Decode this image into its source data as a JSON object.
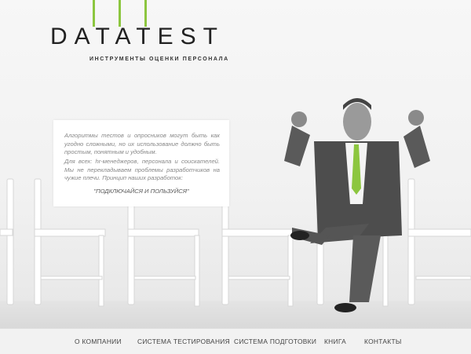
{
  "brand": {
    "logo_text": "DATATEST",
    "tagline": "ИНСТРУМЕНТЫ ОЦЕНКИ ПЕРСОНАЛА",
    "accent_color": "#8cc63f"
  },
  "intro": {
    "paragraph_1": "Алгоритмы тестов и опросников могут быть как угодно сложными, но их использование должно быть простым, понятным и удобным.",
    "paragraph_2": "Для всех: hr-менеджеров, персонала и соискателей. Мы не перекладываем проблемы разработчиков на чужие плечи. Принцип наших разработок:",
    "slogan": "\"ПОДКЛЮЧАЙСЯ И ПОЛЬЗУЙСЯ\""
  },
  "nav": {
    "items": [
      {
        "label": "О КОМПАНИИ"
      },
      {
        "label": "СИСТЕМА ТЕСТИРОВАНИЯ"
      },
      {
        "label": "СИСТЕМА ПОДГОТОВКИ"
      },
      {
        "label": "КНИГА"
      },
      {
        "label": "КОНТАКТЫ"
      }
    ]
  }
}
